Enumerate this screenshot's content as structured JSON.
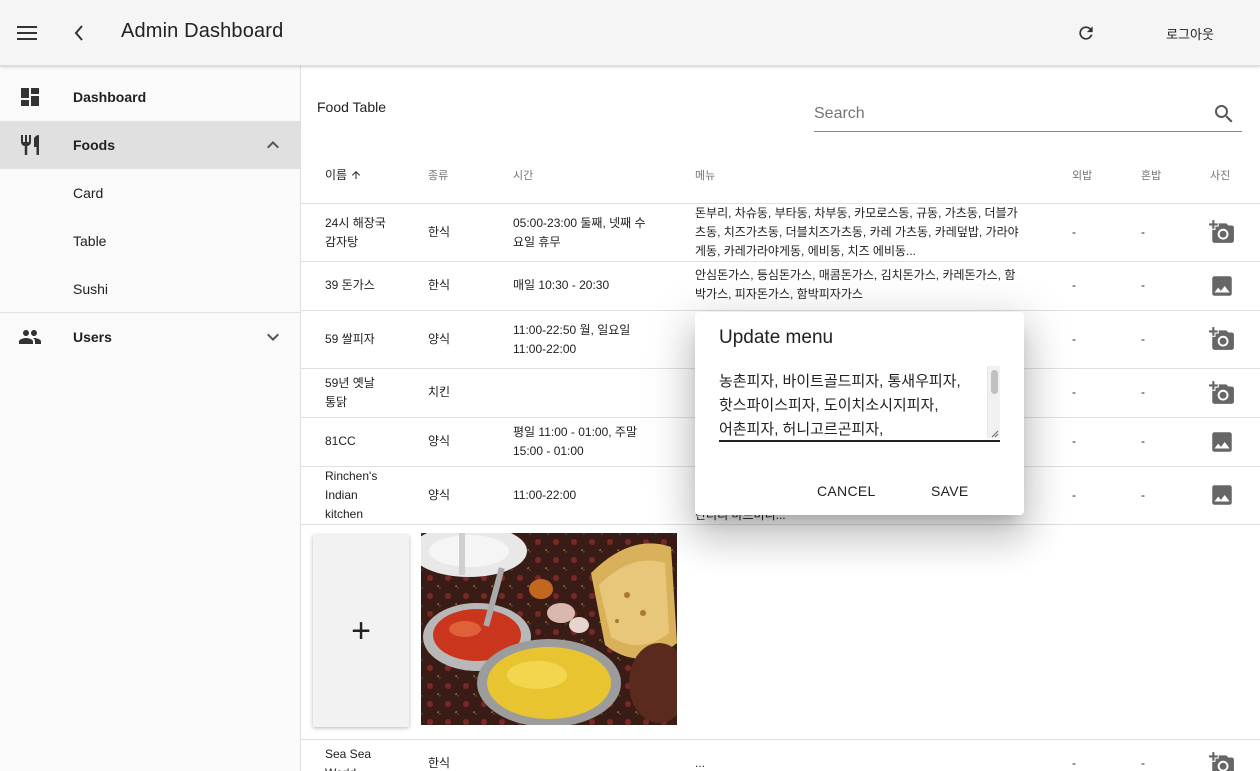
{
  "appbar": {
    "title": "Admin Dashboard",
    "logout_label": "로그아웃"
  },
  "sidebar": {
    "items": [
      {
        "label": "Dashboard",
        "icon": "dashboard-icon"
      },
      {
        "label": "Foods",
        "icon": "restaurant-icon",
        "expanded": true
      },
      {
        "label": "Card"
      },
      {
        "label": "Table"
      },
      {
        "label": "Sushi"
      },
      {
        "label": "Users",
        "icon": "people-icon",
        "expanded": false
      }
    ]
  },
  "table": {
    "title": "Food Table",
    "search_placeholder": "Search",
    "columns": [
      "이름",
      "종류",
      "시간",
      "메뉴",
      "외밥",
      "혼밥",
      "사진"
    ],
    "sorted_column": "이름",
    "rows": [
      {
        "name": "24시 해장국 감자탕",
        "type": "한식",
        "time": "05:00-23:00 둘째, 넷째 수요일 휴무",
        "menu": "돈부리, 차슈동, 부타동, 차부동, 카모로스동, 규동, 가츠동, 더블가츠동, 치즈가츠동, 더블치즈가츠동, 카레 가츠동, 카레덮밥, 가라야게동, 카레가라야게동, 에비동, 치즈 에비동...",
        "col5": "-",
        "col6": "-",
        "photo": "add-photo"
      },
      {
        "name": "39 돈가스",
        "type": "한식",
        "time": "매일 10:30 - 20:30",
        "menu": "안심돈가스, 등심돈가스, 매콤돈가스, 김치돈가스, 카레돈가스, 함박가스, 피자돈가스, 함박피자가스",
        "col5": "-",
        "col6": "-",
        "photo": "image"
      },
      {
        "name": "59 쌀피자",
        "type": "양식",
        "time": "11:00-22:50 월, 일요일 11:00-22:00",
        "menu": "",
        "col5": "-",
        "col6": "-",
        "photo": "add-photo"
      },
      {
        "name": "59년 옛날 통닭",
        "type": "치킨",
        "time": "",
        "menu": "",
        "col5": "-",
        "col6": "-",
        "photo": "add-photo"
      },
      {
        "name": "81CC",
        "type": "양식",
        "time": "평일 11:00 - 01:00, 주말 15:00 - 01:00",
        "menu": "",
        "col5": "-",
        "col6": "-",
        "photo": "image"
      },
      {
        "name": "Rinchen's Indian kitchen",
        "type": "양식",
        "time": "11:00-22:00",
        "menu": "탄더리 마드미디...",
        "col5": "-",
        "col6": "-",
        "photo": "image"
      },
      {
        "name": "Sea Sea World",
        "type": "한식",
        "time": "",
        "menu": "...",
        "col5": "-",
        "col6": "-",
        "photo": "add-photo"
      }
    ]
  },
  "expanded_row": {
    "add_label": "+"
  },
  "dialog": {
    "title": "Update menu",
    "textarea_value": "농촌피자, 바이트골드피자, 통새우피자, 핫스파이스피자, 도이치소시지피자, 어촌피자, 허니고르곤피자, 통감자새우피자, 게살",
    "cancel_label": "CANCEL",
    "save_label": "SAVE"
  },
  "colors": {
    "appbar_bg": "#f5f5f5",
    "active_nav_bg": "#e0e0e0",
    "text_primary": "#212121",
    "text_secondary": "#757575"
  }
}
